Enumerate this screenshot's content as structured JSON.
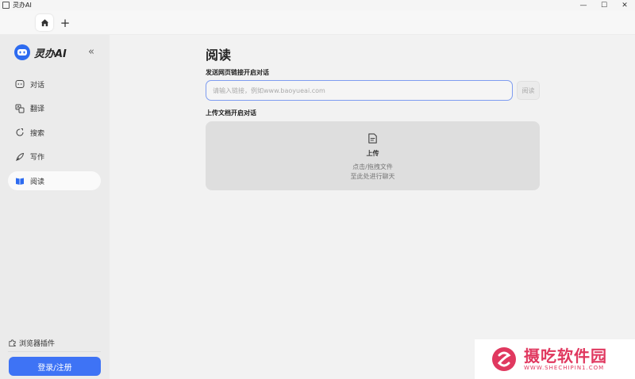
{
  "window": {
    "title": "灵办AI",
    "controls": {
      "minimize": "—",
      "maximize": "☐",
      "close": "✕"
    }
  },
  "tabs": {
    "add_label": "+"
  },
  "sidebar": {
    "brand": "灵办AI",
    "collapse_icon": "«",
    "items": [
      {
        "label": "对话",
        "icon": "chat-icon",
        "active": false
      },
      {
        "label": "翻译",
        "icon": "translate-icon",
        "active": false
      },
      {
        "label": "搜索",
        "icon": "search-icon",
        "active": false
      },
      {
        "label": "写作",
        "icon": "pen-icon",
        "active": false
      },
      {
        "label": "阅读",
        "icon": "book-icon",
        "active": true
      }
    ],
    "plugin_label": "浏览器插件",
    "login_label": "登录/注册"
  },
  "main": {
    "title": "阅读",
    "link_section_label": "发送网页链接开启对话",
    "url_placeholder": "请输入链接，例如www.baoyueai.com",
    "read_button": "阅读",
    "upload_section_label": "上传文档开启对话",
    "upload": {
      "title": "上传",
      "hint_line1": "点击/拖拽文件",
      "hint_line2": "至此处进行聊天"
    }
  },
  "watermark": {
    "cn": "摄吃软件园",
    "en": "WWW.SHECHIPIN1.COM"
  },
  "colors": {
    "accent": "#3e73f5",
    "input_border": "#7e9cf0",
    "watermark": "#e0385f"
  }
}
